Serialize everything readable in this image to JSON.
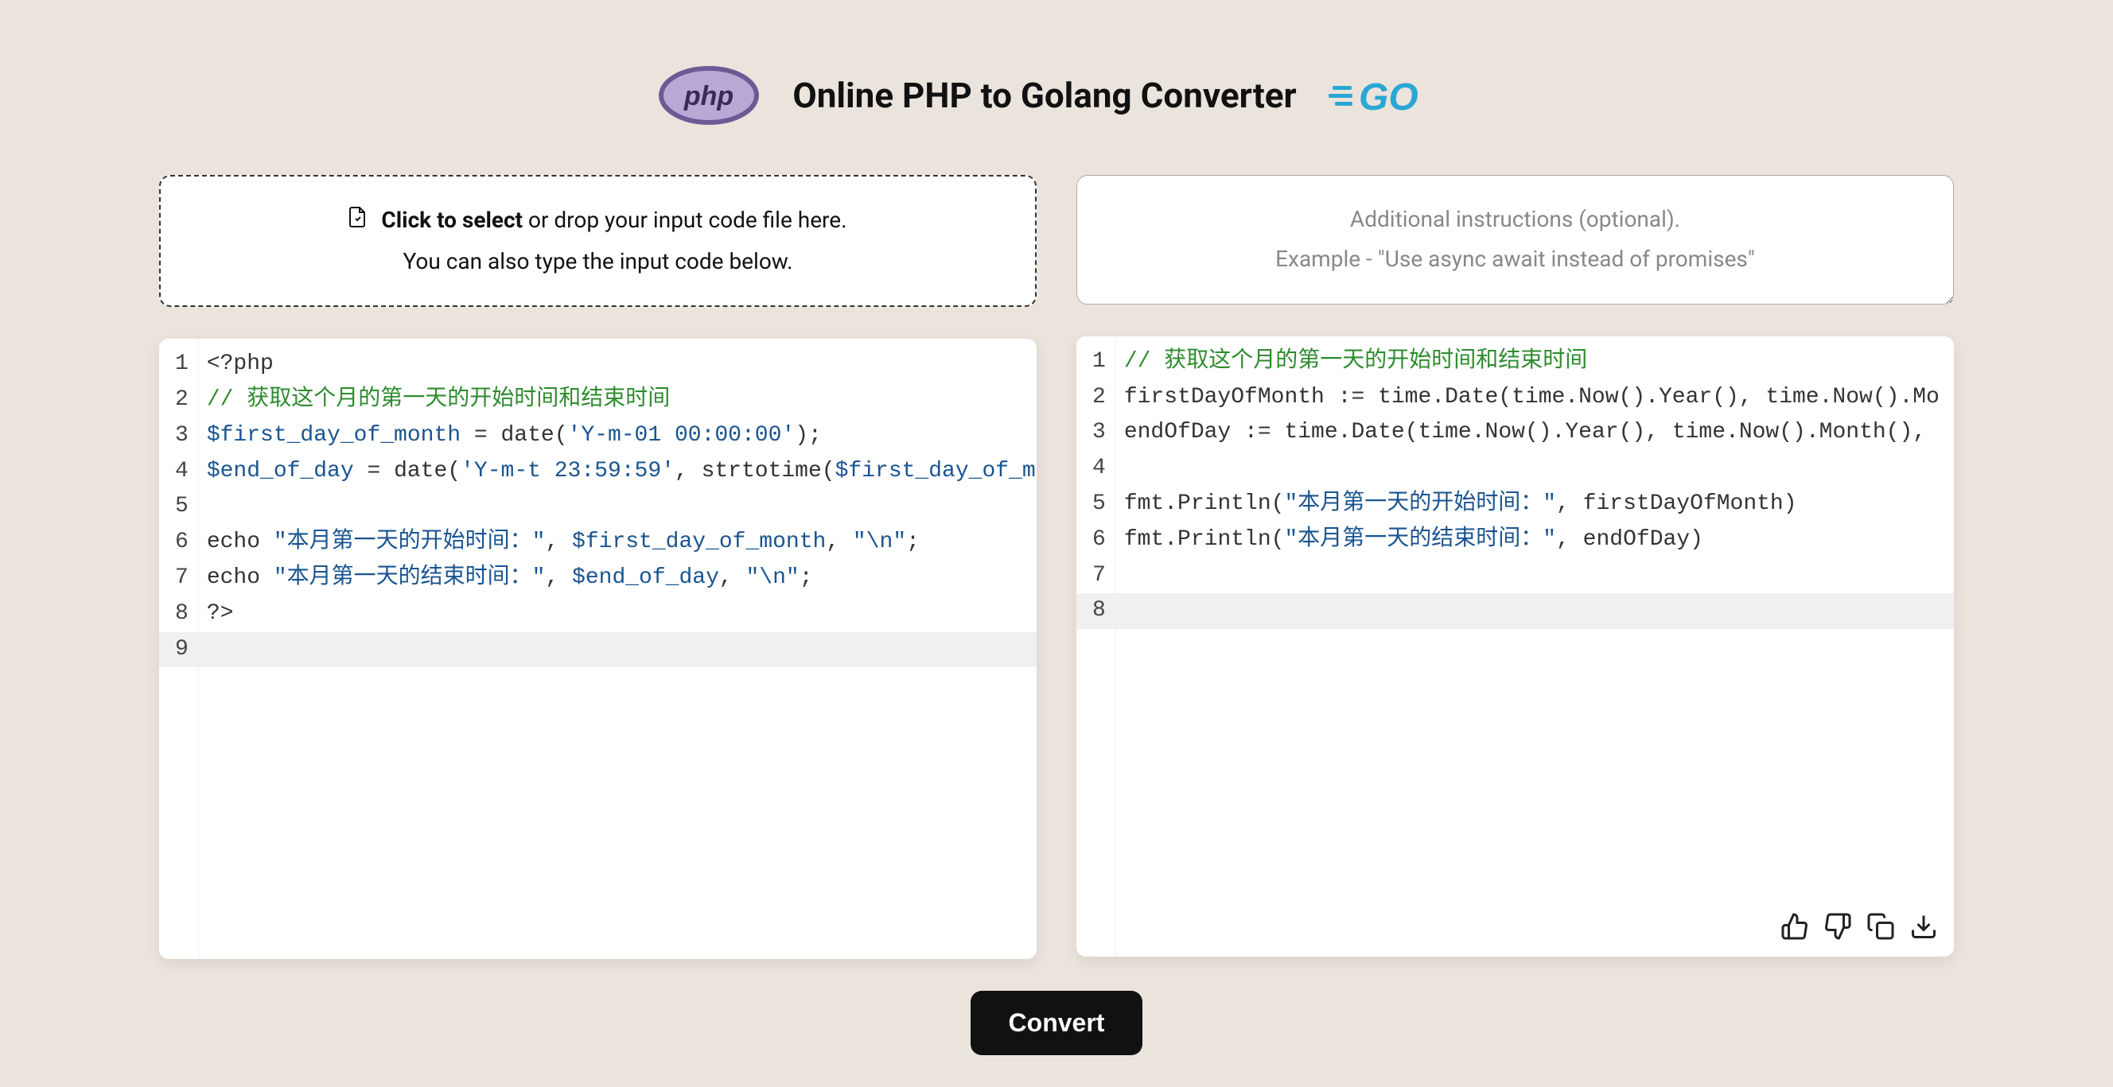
{
  "header": {
    "title": "Online PHP to Golang Converter"
  },
  "dropzone": {
    "click_text": "Click to select",
    "drop_text": " or drop your input code file here.",
    "type_text": "You can also type the input code below."
  },
  "instructions": {
    "line1": "Additional instructions (optional).",
    "line2": "Example - \"Use async await instead of promises\""
  },
  "left_editor": {
    "lines": [
      {
        "n": 1,
        "segs": [
          {
            "t": "<?php",
            "c": "tk-tag"
          }
        ]
      },
      {
        "n": 2,
        "segs": [
          {
            "t": "// 获取这个月的第一天的开始时间和结束时间",
            "c": "tk-comment"
          }
        ]
      },
      {
        "n": 3,
        "segs": [
          {
            "t": "$first_day_of_month",
            "c": "tk-var"
          },
          {
            "t": " = ",
            "c": "tk-op"
          },
          {
            "t": "date",
            "c": "tk-fn"
          },
          {
            "t": "(",
            "c": "tk-op"
          },
          {
            "t": "'Y-m-01 00:00:00'",
            "c": "tk-str"
          },
          {
            "t": ");",
            "c": "tk-op"
          }
        ]
      },
      {
        "n": 4,
        "segs": [
          {
            "t": "$end_of_day",
            "c": "tk-var"
          },
          {
            "t": " = ",
            "c": "tk-op"
          },
          {
            "t": "date",
            "c": "tk-fn"
          },
          {
            "t": "(",
            "c": "tk-op"
          },
          {
            "t": "'Y-m-t 23:59:59'",
            "c": "tk-str"
          },
          {
            "t": ", ",
            "c": "tk-op"
          },
          {
            "t": "strtotime",
            "c": "tk-fn"
          },
          {
            "t": "(",
            "c": "tk-op"
          },
          {
            "t": "$first_day_of_m",
            "c": "tk-var"
          }
        ]
      },
      {
        "n": 5,
        "segs": []
      },
      {
        "n": 6,
        "segs": [
          {
            "t": "echo ",
            "c": "tk-key"
          },
          {
            "t": "\"本月第一天的开始时间：\"",
            "c": "tk-str"
          },
          {
            "t": ", ",
            "c": "tk-op"
          },
          {
            "t": "$first_day_of_month",
            "c": "tk-var"
          },
          {
            "t": ", ",
            "c": "tk-op"
          },
          {
            "t": "\"\\n\"",
            "c": "tk-str"
          },
          {
            "t": ";",
            "c": "tk-op"
          }
        ]
      },
      {
        "n": 7,
        "segs": [
          {
            "t": "echo ",
            "c": "tk-key"
          },
          {
            "t": "\"本月第一天的结束时间：\"",
            "c": "tk-str"
          },
          {
            "t": ", ",
            "c": "tk-op"
          },
          {
            "t": "$end_of_day",
            "c": "tk-var"
          },
          {
            "t": ", ",
            "c": "tk-op"
          },
          {
            "t": "\"\\n\"",
            "c": "tk-str"
          },
          {
            "t": ";",
            "c": "tk-op"
          }
        ]
      },
      {
        "n": 8,
        "segs": [
          {
            "t": "?>",
            "c": "tk-tag"
          }
        ]
      },
      {
        "n": 9,
        "segs": []
      }
    ],
    "current_line": 9
  },
  "right_editor": {
    "lines": [
      {
        "n": 1,
        "segs": [
          {
            "t": "// 获取这个月的第一天的开始时间和结束时间",
            "c": "tk-comment"
          }
        ]
      },
      {
        "n": 2,
        "segs": [
          {
            "t": "firstDayOfMonth := time.",
            "c": "tk-op"
          },
          {
            "t": "Date",
            "c": "tk-fn"
          },
          {
            "t": "(time.",
            "c": "tk-op"
          },
          {
            "t": "Now",
            "c": "tk-fn"
          },
          {
            "t": "().",
            "c": "tk-op"
          },
          {
            "t": "Year",
            "c": "tk-fn"
          },
          {
            "t": "(), time.",
            "c": "tk-op"
          },
          {
            "t": "Now",
            "c": "tk-fn"
          },
          {
            "t": "().Mo",
            "c": "tk-op"
          }
        ]
      },
      {
        "n": 3,
        "segs": [
          {
            "t": "endOfDay := time.",
            "c": "tk-op"
          },
          {
            "t": "Date",
            "c": "tk-fn"
          },
          {
            "t": "(time.",
            "c": "tk-op"
          },
          {
            "t": "Now",
            "c": "tk-fn"
          },
          {
            "t": "().",
            "c": "tk-op"
          },
          {
            "t": "Year",
            "c": "tk-fn"
          },
          {
            "t": "(), time.",
            "c": "tk-op"
          },
          {
            "t": "Now",
            "c": "tk-fn"
          },
          {
            "t": "().",
            "c": "tk-op"
          },
          {
            "t": "Month",
            "c": "tk-fn"
          },
          {
            "t": "(), ",
            "c": "tk-op"
          }
        ]
      },
      {
        "n": 4,
        "segs": []
      },
      {
        "n": 5,
        "segs": [
          {
            "t": "fmt.",
            "c": "tk-op"
          },
          {
            "t": "Println",
            "c": "tk-fn"
          },
          {
            "t": "(",
            "c": "tk-op"
          },
          {
            "t": "\"本月第一天的开始时间：\"",
            "c": "tk-str"
          },
          {
            "t": ", firstDayOfMonth)",
            "c": "tk-op"
          }
        ]
      },
      {
        "n": 6,
        "segs": [
          {
            "t": "fmt.",
            "c": "tk-op"
          },
          {
            "t": "Println",
            "c": "tk-fn"
          },
          {
            "t": "(",
            "c": "tk-op"
          },
          {
            "t": "\"本月第一天的结束时间：\"",
            "c": "tk-str"
          },
          {
            "t": ", endOfDay)",
            "c": "tk-op"
          }
        ]
      },
      {
        "n": 7,
        "segs": []
      },
      {
        "n": 8,
        "segs": []
      }
    ],
    "current_line": 8
  },
  "convert": {
    "label": "Convert"
  }
}
